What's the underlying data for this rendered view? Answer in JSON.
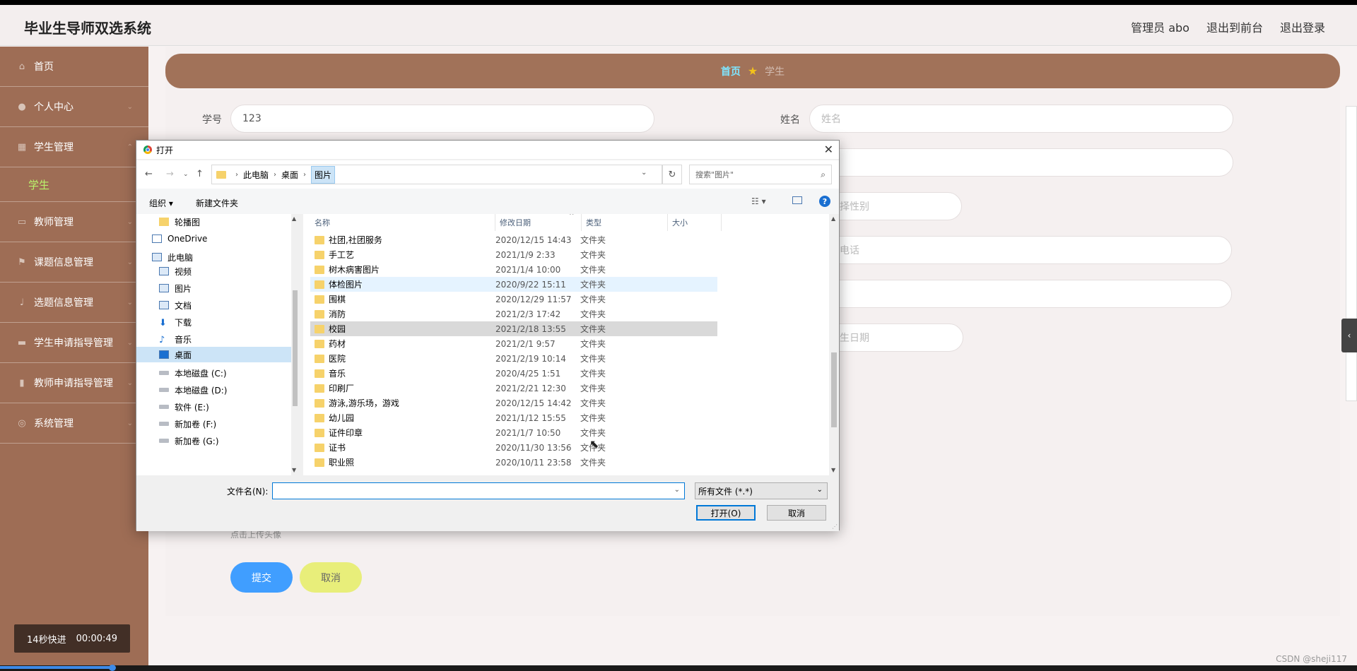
{
  "header": {
    "brand": "毕业生导师双选系统",
    "links": [
      "管理员 abo",
      "退出到前台",
      "退出登录"
    ]
  },
  "sidebar": {
    "items": [
      {
        "label": "首页",
        "icon": "home-icon",
        "has_chevron": false
      },
      {
        "label": "个人中心",
        "icon": "user-icon",
        "has_chevron": true
      },
      {
        "label": "学生管理",
        "icon": "grid-icon",
        "has_chevron": true
      }
    ],
    "submenu": "学生",
    "items_after": [
      {
        "label": "教师管理",
        "icon": "chat-icon",
        "has_chevron": true
      },
      {
        "label": "课题信息管理",
        "icon": "flag-icon",
        "has_chevron": true
      },
      {
        "label": "选题信息管理",
        "icon": "mic-icon",
        "has_chevron": true
      },
      {
        "label": "学生申请指导管理",
        "icon": "book-icon",
        "has_chevron": true
      },
      {
        "label": "教师申请指导管理",
        "icon": "bars-icon",
        "has_chevron": true
      },
      {
        "label": "系统管理",
        "icon": "compass-icon",
        "has_chevron": true
      }
    ]
  },
  "timer": {
    "text": "14秒快进",
    "time": "00:00:49"
  },
  "breadcrumb": {
    "home": "首页",
    "current": "学生"
  },
  "form": {
    "student_id_label": "学号",
    "student_id_value": "123",
    "name_label": "姓名",
    "name_placeholder": "姓名",
    "gender_placeholder": "择性别",
    "phone_placeholder": "电话",
    "birth_placeholder": "生日期",
    "upload_hint": "点击上传头像",
    "submit": "提交",
    "cancel": "取消"
  },
  "dialog": {
    "title": "打开",
    "breadcrumb": [
      "此电脑",
      "桌面",
      "图片"
    ],
    "search_placeholder": "搜索\"图片\"",
    "organize": "组织 ▾",
    "new_folder": "新建文件夹",
    "help": "?",
    "nav_items": [
      {
        "label": "轮播图",
        "icon": "folder"
      },
      {
        "label": "OneDrive",
        "icon": "cloud"
      },
      {
        "label": "此电脑",
        "icon": "pc"
      },
      {
        "label": "视频",
        "icon": "pc"
      },
      {
        "label": "图片",
        "icon": "pc"
      },
      {
        "label": "文档",
        "icon": "pc"
      },
      {
        "label": "下载",
        "icon": "download"
      },
      {
        "label": "音乐",
        "icon": "music"
      },
      {
        "label": "桌面",
        "icon": "pc"
      },
      {
        "label": "本地磁盘 (C:)",
        "icon": "drive"
      },
      {
        "label": "本地磁盘 (D:)",
        "icon": "drive"
      },
      {
        "label": "软件 (E:)",
        "icon": "drive"
      },
      {
        "label": "新加卷 (F:)",
        "icon": "drive"
      },
      {
        "label": "新加卷 (G:)",
        "icon": "drive"
      }
    ],
    "columns": [
      "名称",
      "修改日期",
      "类型",
      "大小"
    ],
    "files": [
      {
        "name": "社团,社团服务",
        "date": "2020/12/15 14:43",
        "type": "文件夹"
      },
      {
        "name": "手工艺",
        "date": "2021/1/9 2:33",
        "type": "文件夹"
      },
      {
        "name": "树木病害图片",
        "date": "2021/1/4 10:00",
        "type": "文件夹"
      },
      {
        "name": "体检图片",
        "date": "2020/9/22 15:11",
        "type": "文件夹"
      },
      {
        "name": "围棋",
        "date": "2020/12/29 11:57",
        "type": "文件夹"
      },
      {
        "name": "消防",
        "date": "2021/2/3 17:42",
        "type": "文件夹"
      },
      {
        "name": "校园",
        "date": "2021/2/18 13:55",
        "type": "文件夹"
      },
      {
        "name": "药材",
        "date": "2021/2/1 9:57",
        "type": "文件夹"
      },
      {
        "name": "医院",
        "date": "2021/2/19 10:14",
        "type": "文件夹"
      },
      {
        "name": "音乐",
        "date": "2020/4/25 1:51",
        "type": "文件夹"
      },
      {
        "name": "印刷厂",
        "date": "2021/2/21 12:30",
        "type": "文件夹"
      },
      {
        "name": "游泳,游乐场，游戏",
        "date": "2020/12/15 14:42",
        "type": "文件夹"
      },
      {
        "name": "幼儿园",
        "date": "2021/1/12 15:55",
        "type": "文件夹"
      },
      {
        "name": "证件印章",
        "date": "2021/1/7 10:50",
        "type": "文件夹"
      },
      {
        "name": "证书",
        "date": "2020/11/30 13:56",
        "type": "文件夹"
      },
      {
        "name": "职业照",
        "date": "2020/10/11 23:58",
        "type": "文件夹"
      }
    ],
    "filename_label": "文件名(N):",
    "filename_value": "",
    "filetype": "所有文件 (*.*)",
    "open_button": "打开(O)",
    "cancel_button": "取消"
  },
  "watermark": "CSDN @sheji117",
  "colors": {
    "sidebar": "#9e6d55",
    "breadcrumb_bg": "#a17259",
    "submenu_active": "#b9f26b",
    "submit": "#409eff",
    "cancel": "#e8ee7a"
  }
}
